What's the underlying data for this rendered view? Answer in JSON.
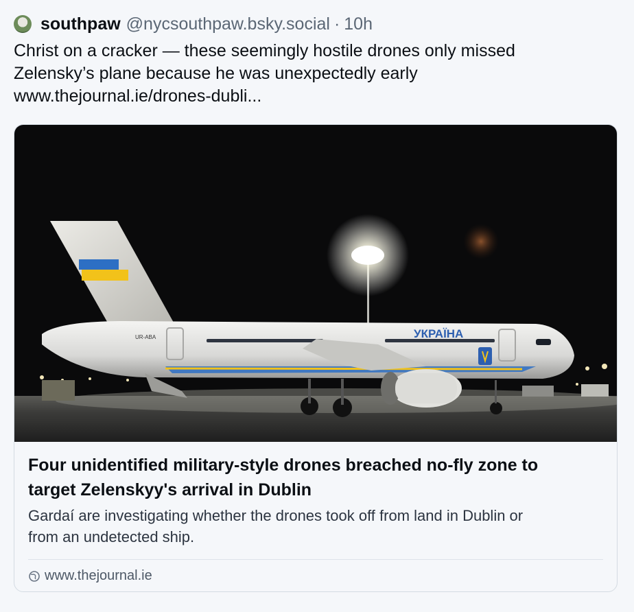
{
  "post": {
    "display_name": "southpaw",
    "handle": "@nycsouthpaw.bsky.social",
    "separator": "·",
    "time": "10h",
    "text_lines": [
      "Christ on a cracker — these seemingly hostile drones only missed",
      "Zelensky’s plane because he was unexpectedly early"
    ],
    "link_text": "www.thejournal.ie/drones-dubli..."
  },
  "card": {
    "image_plane_text": "УКРАЇНА",
    "image_registration": "UR-ABA",
    "title_lines": [
      "Four unidentified military-style drones breached no-fly zone to",
      "target Zelenskyy's arrival in Dublin"
    ],
    "description_lines": [
      "Gardaí are investigating whether the drones took off from land in Dublin or",
      "from an undetected ship."
    ],
    "domain": "www.thejournal.ie"
  },
  "colors": {
    "background": "#f5f7fa",
    "text": "#0b0f14",
    "muted": "#5b6775",
    "border": "#d4dbe2"
  },
  "icons": {
    "avatar": "avatar",
    "domain": "globe-icon"
  }
}
